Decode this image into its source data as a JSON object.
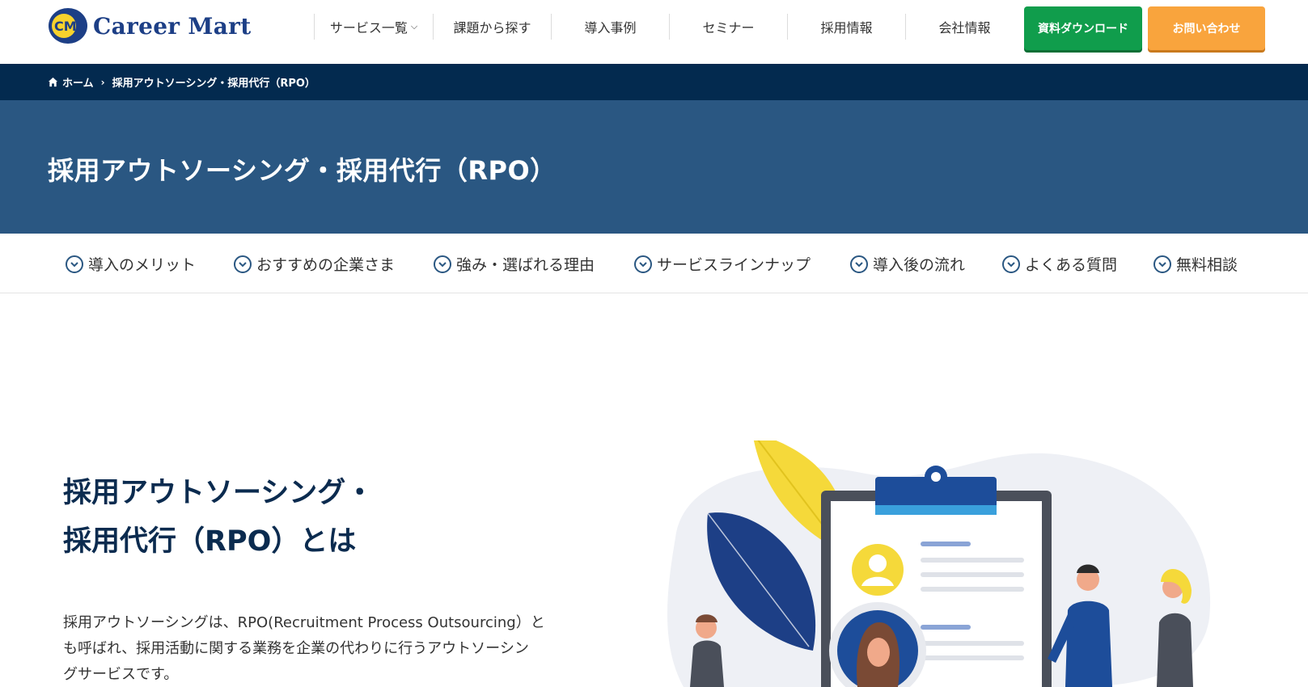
{
  "header": {
    "logo_text": "Career Mart",
    "logo_badge": "CM",
    "nav": [
      {
        "label": "サービス一覧",
        "has_dropdown": true
      },
      {
        "label": "課題から探す"
      },
      {
        "label": "導入事例"
      },
      {
        "label": "セミナー"
      },
      {
        "label": "採用情報"
      },
      {
        "label": "会社情報"
      }
    ],
    "download_button": "資料ダウンロード",
    "contact_button": "お問い合わせ"
  },
  "breadcrumb": {
    "home": "ホーム",
    "current": "採用アウトソーシング・採用代行（RPO）"
  },
  "hero": {
    "title": "採用アウトソーシング・採用代行（RPO）"
  },
  "anchors": [
    "導入のメリット",
    "おすすめの企業さま",
    "強み・選ばれる理由",
    "サービスラインナップ",
    "導入後の流れ",
    "よくある質問",
    "無料相談"
  ],
  "intro": {
    "title_line1": "採用アウトソーシング・",
    "title_line2": "採用代行（RPO）とは",
    "text_line1": "採用アウトソーシングは、RPO(Recruitment Process Outsourcing）と",
    "text_line2": "も呼ばれ、採用活動に関する業務を企業の代わりに行うアウトソーシン",
    "text_line3": "グサービスです。"
  },
  "colors": {
    "brand_navy": "#032a4f",
    "hero_blue": "#2a5782",
    "green": "#109d4c",
    "orange": "#f9a43d",
    "logo_yellow": "#f7d22d"
  },
  "icons": [
    "home-icon",
    "chevron-right-icon",
    "chevron-down-icon",
    "circle-chevron-down-icon"
  ]
}
